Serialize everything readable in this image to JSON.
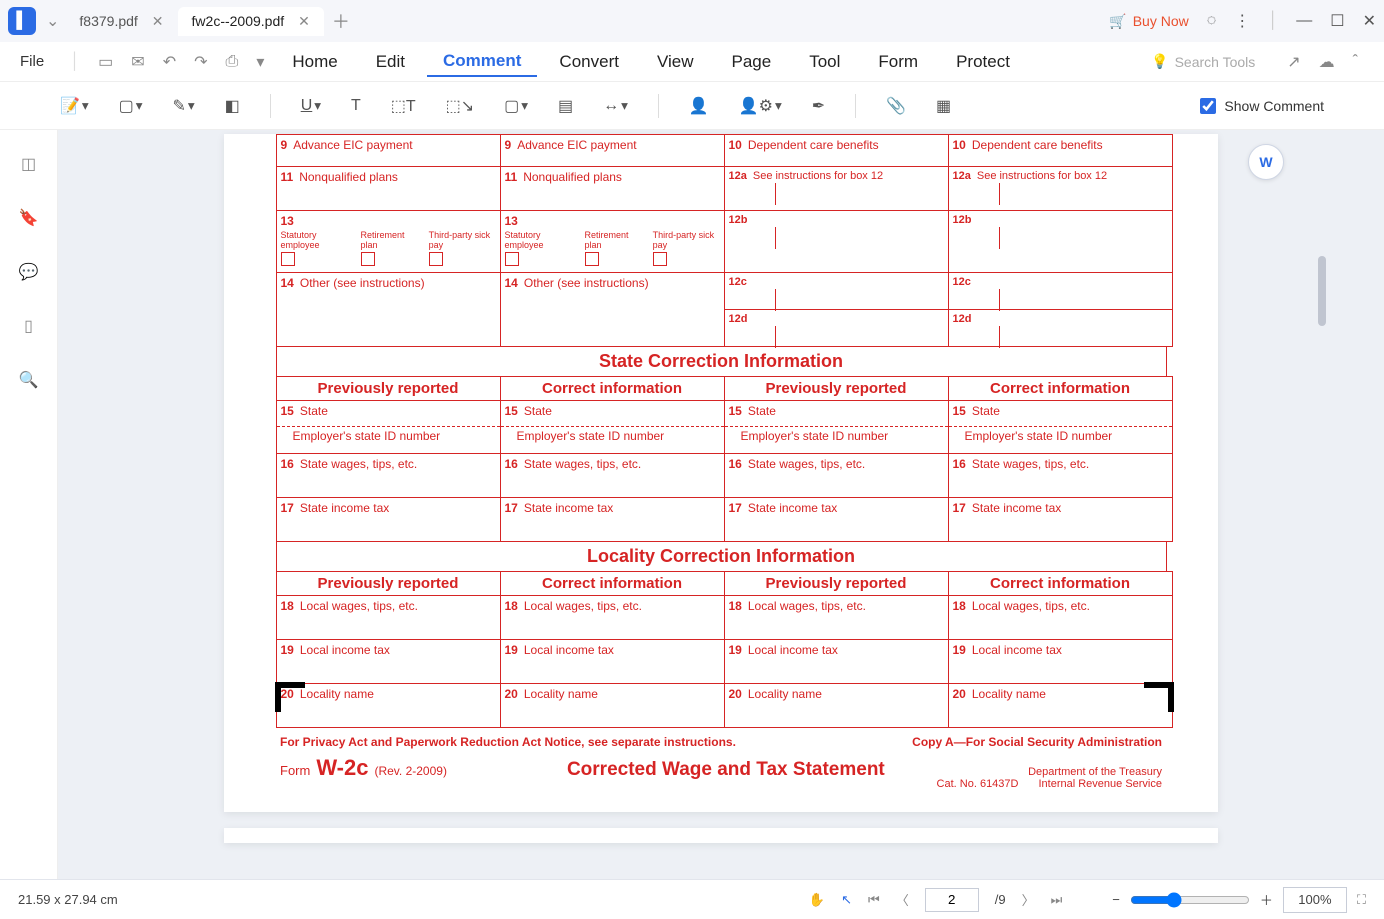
{
  "titlebar": {
    "tabs": [
      {
        "label": "f8379.pdf",
        "active": false
      },
      {
        "label": "fw2c--2009.pdf",
        "active": true
      }
    ],
    "buy_now": "Buy Now"
  },
  "menubar": {
    "file": "File",
    "items": [
      "Home",
      "Edit",
      "Comment",
      "Convert",
      "View",
      "Page",
      "Tool",
      "Form",
      "Protect"
    ],
    "active": "Comment",
    "search_placeholder": "Search Tools"
  },
  "toolbar": {
    "show_comment": "Show Comment",
    "show_comment_checked": true
  },
  "form_rows_top": [
    {
      "cols": [
        {
          "n": "9",
          "t": "Advance EIC payment"
        },
        {
          "n": "9",
          "t": "Advance EIC payment"
        },
        {
          "n": "10",
          "t": "Dependent care benefits"
        },
        {
          "n": "10",
          "t": "Dependent care benefits"
        }
      ]
    },
    {
      "cols": [
        {
          "n": "11",
          "t": "Nonqualified plans"
        },
        {
          "n": "11",
          "t": "Nonqualified plans"
        },
        {
          "n": "12a",
          "t": "See instructions for box 12"
        },
        {
          "n": "12a",
          "t": "See instructions for box 12"
        }
      ]
    }
  ],
  "row13": {
    "n": "13",
    "opts": [
      "Statutory employee",
      "Retirement plan",
      "Third-party sick pay"
    ],
    "right": [
      {
        "n": "12b"
      },
      {
        "n": "12b"
      }
    ]
  },
  "row14": {
    "n": "14",
    "t": "Other (see instructions)",
    "right": [
      {
        "n": "12c"
      },
      {
        "n": "12c"
      }
    ]
  },
  "row12d": [
    {
      "n": "12d"
    },
    {
      "n": "12d"
    }
  ],
  "sections": [
    {
      "header": "State Correction Information",
      "cols": [
        "Previously reported",
        "Correct information",
        "Previously reported",
        "Correct information"
      ],
      "rows": [
        {
          "n": "15",
          "t": "State",
          "sub": "Employer's state ID number"
        },
        {
          "n": "16",
          "t": "State wages, tips, etc."
        },
        {
          "n": "17",
          "t": "State income tax"
        }
      ]
    },
    {
      "header": "Locality Correction Information",
      "cols": [
        "Previously reported",
        "Correct information",
        "Previously reported",
        "Correct information"
      ],
      "rows": [
        {
          "n": "18",
          "t": "Local wages, tips, etc."
        },
        {
          "n": "19",
          "t": "Local income tax"
        },
        {
          "n": "20",
          "t": "Locality name"
        }
      ]
    }
  ],
  "footer": {
    "privacy": "For Privacy Act and Paperwork Reduction Act Notice, see separate instructions.",
    "copy": "Copy A—For Social Security Administration",
    "form_word": "Form",
    "form_code": "W-2c",
    "rev": "(Rev. 2-2009)",
    "title": "Corrected Wage and Tax Statement",
    "cat": "Cat. No. 61437D",
    "dept": "Department of the Treasury",
    "irs": "Internal Revenue Service"
  },
  "status": {
    "dims": "21.59 x 27.94 cm",
    "page": "2",
    "total": "/9",
    "zoom": "100%"
  }
}
